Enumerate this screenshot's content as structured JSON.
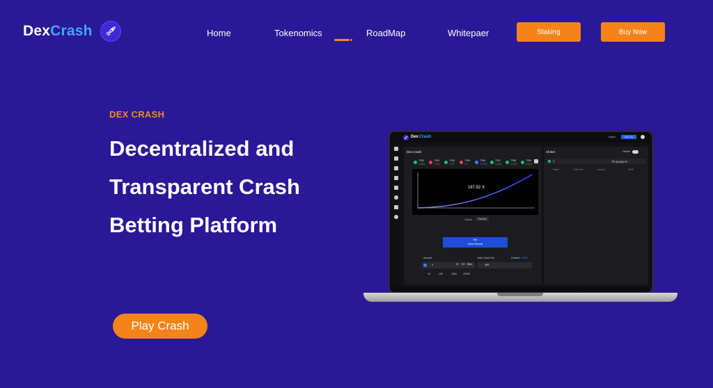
{
  "brand": {
    "logo_dex": "Dex",
    "logo_crash": "Crash",
    "logo_icon": "rocket-icon"
  },
  "nav": {
    "links": [
      {
        "label": "Home"
      },
      {
        "label": "Tokenomics"
      },
      {
        "label": "RoadMap"
      },
      {
        "label": "Whitepaer"
      }
    ],
    "staking_label": "Staking",
    "buy_label": "Buy Now"
  },
  "hero": {
    "eyebrow": "DEX CRASH",
    "headline_lines": [
      "Decentralized and",
      "Transparent Crash",
      "Betting Platform"
    ],
    "cta_label": "Play Crash"
  },
  "colors": {
    "background": "#2a1896",
    "accent": "#f4841a",
    "brand_blue": "#3ea8ff"
  },
  "app_preview": {
    "brand_dex": "Dex",
    "brand_crash": "Crash",
    "login": "Log In",
    "signup": "Sign Up",
    "game_title": "Dex Crash",
    "history": [
      {
        "id": "7292",
        "value": "3.22X",
        "color": "#22c55e"
      },
      {
        "id": "7293",
        "value": "1.09X",
        "color": "#ef4444"
      },
      {
        "id": "7294",
        "value": "2.2X",
        "color": "#22c55e"
      },
      {
        "id": "7295",
        "value": "1X",
        "color": "#ef4444"
      },
      {
        "id": "7296",
        "value": "10.32X",
        "color": "#3b82f6"
      },
      {
        "id": "7297",
        "value": "3.15X",
        "color": "#22c55e"
      },
      {
        "id": "7298",
        "value": "2.20X",
        "color": "#22c55e"
      },
      {
        "id": "7299",
        "value": "5.47X",
        "color": "#22c55e"
      }
    ],
    "multiplier": "187.92 X",
    "tab_classic": "Classic",
    "tab_trenball": "Trenball",
    "bet_label": "Bet",
    "bet_sub": "(Next Round)",
    "amount_label": "Amount",
    "amount_value": "1",
    "half": "/2",
    "double": "X2",
    "max": "Max",
    "quick_amounts": [
      "10",
      "100",
      "1000",
      "10000"
    ],
    "auto_cashout_label": "Auto Cash Out",
    "chance_label": "Chance",
    "chance_value": "0.99%",
    "auto_cashout_value": "100",
    "all_bet_title": "All Bet",
    "online_label": "Online",
    "players_count": "1",
    "total_amount": "₹7,64,031.07",
    "columns": [
      "Player",
      "Cash Out",
      "Amount",
      "Profit"
    ]
  }
}
